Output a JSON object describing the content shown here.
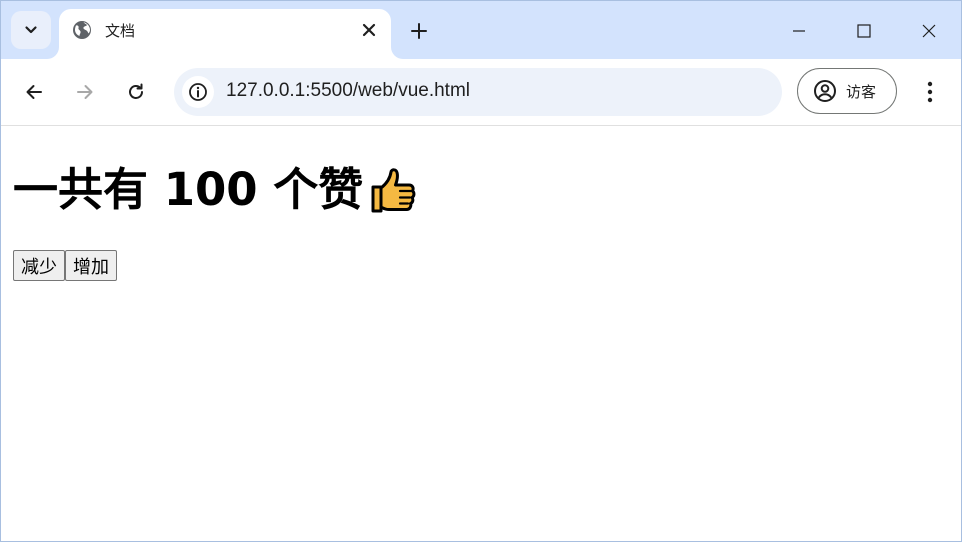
{
  "browser": {
    "tab": {
      "title": "文档",
      "favicon": "globe-icon"
    },
    "address_bar": {
      "url": "127.0.0.1:5500/web/vue.html"
    },
    "profile": {
      "label": "访客"
    }
  },
  "page": {
    "heading": {
      "prefix": "一共有",
      "count": "100",
      "suffix": "个赞",
      "emoji": "thumbs-up-icon"
    },
    "buttons": {
      "decrease": "减少",
      "increase": "增加"
    }
  },
  "colors": {
    "tabstrip": "#d3e3fd",
    "omnibox": "#edf2fa",
    "thumb": "#f5b942"
  }
}
